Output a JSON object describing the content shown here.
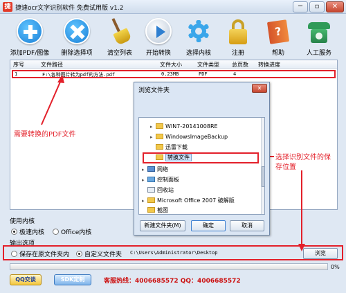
{
  "window": {
    "title": "捷速ocr文字识别软件 免费试用版 v1.2",
    "controls": {
      "minimize": "─",
      "restore": "▫",
      "close": "✕"
    }
  },
  "toolbar": [
    {
      "label": "添加PDF/图像",
      "icon": "plus-circle-icon"
    },
    {
      "label": "删除选择项",
      "icon": "x-circle-icon"
    },
    {
      "label": "清空列表",
      "icon": "broom-icon"
    },
    {
      "label": "开始转换",
      "icon": "play-circle-icon"
    },
    {
      "label": "选择内核",
      "icon": "gear-icon"
    },
    {
      "label": "注册",
      "icon": "lock-icon"
    },
    {
      "label": "帮助",
      "icon": "help-book-icon"
    },
    {
      "label": "人工服务",
      "icon": "telephone-icon"
    }
  ],
  "file_table": {
    "columns": [
      "序号",
      "文件路径",
      "文件大小",
      "文件类型",
      "总页数",
      "转换进度"
    ],
    "rows": [
      {
        "index": "1",
        "path": "F:\\各种图片转为pdf的方法.pdf",
        "size": "0.23MB",
        "type": "PDF",
        "pages": "4",
        "progress": ""
      }
    ]
  },
  "dialog": {
    "title": "浏览文件夹",
    "close": "✕",
    "tree": [
      {
        "label": "WIN7-20141008RE",
        "type": "folder",
        "expander": "▸"
      },
      {
        "label": "WindowsImageBackup",
        "type": "folder",
        "expander": "▸"
      },
      {
        "label": "迅雷下载",
        "type": "folder",
        "expander": ""
      },
      {
        "label": "转换文件",
        "type": "folder",
        "expander": "",
        "selected": true
      },
      {
        "label": "网络",
        "type": "network",
        "expander": "▸"
      },
      {
        "label": "控制面板",
        "type": "control-panel",
        "expander": "▸"
      },
      {
        "label": "回收站",
        "type": "recycle-bin",
        "expander": ""
      },
      {
        "label": "Microsoft Office 2007 破解版",
        "type": "folder",
        "expander": "▸"
      },
      {
        "label": "截图",
        "type": "folder",
        "expander": ""
      }
    ],
    "new_folder_button": "新建文件夹(M)",
    "ok_button": "确定",
    "cancel_button": "取消"
  },
  "annotations": {
    "pdf_file_note": "需要转换的PDF文件",
    "save_location_note_line1": "选择识别文件的保",
    "save_location_note_line2": "存位置"
  },
  "kernel": {
    "section_label": "使用内核",
    "options": [
      {
        "label": "极速内核",
        "checked": true
      },
      {
        "label": "Office内核",
        "checked": false
      }
    ]
  },
  "output": {
    "section_label": "输出选项",
    "options": [
      {
        "label": "保存在原文件夹内",
        "checked": false
      },
      {
        "label": "自定义文件夹",
        "checked": true
      }
    ],
    "path": "C:\\Users\\Administrator\\Desktop",
    "browse_button": "浏览"
  },
  "progress": {
    "percent_label": "0%",
    "value": 0
  },
  "footer": {
    "qq_button": "QQ交谈",
    "sdk_button": "SDK定制",
    "hotline": "客服热线：4006685572 QQ：4006685572"
  },
  "colors": {
    "annotation_red": "#e3202a",
    "hotline_red": "#cc1111"
  }
}
